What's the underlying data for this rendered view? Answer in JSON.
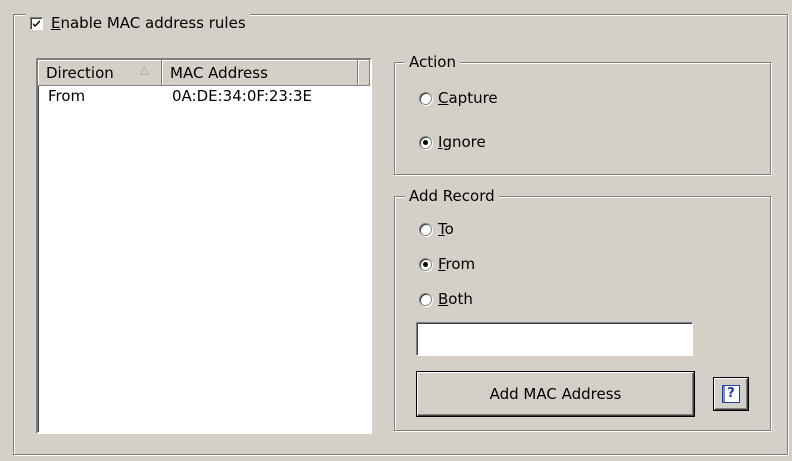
{
  "mac_rules": {
    "enable_label": "Enable MAC address rules",
    "enabled": true
  },
  "list": {
    "columns": [
      "Direction",
      "MAC Address"
    ],
    "sort_indicator": "△",
    "rows": [
      {
        "direction": "From",
        "mac": "0A:DE:34:0F:23:3E"
      }
    ]
  },
  "action": {
    "title": "Action",
    "options": [
      {
        "label": "Capture",
        "selected": false
      },
      {
        "label": "Ignore",
        "selected": true
      }
    ]
  },
  "add_record": {
    "title": "Add Record",
    "options": [
      {
        "label": "To",
        "selected": false
      },
      {
        "label": "From",
        "selected": true
      },
      {
        "label": "Both",
        "selected": false
      }
    ],
    "mac_input_value": "",
    "add_button_label": "Add MAC Address",
    "help_icon": "help-book-icon",
    "help_icon_glyph": "?"
  },
  "colors": {
    "dialog_bg": "#d4d0c8",
    "shadow": "#808080",
    "highlight": "#ffffff",
    "help_icon_blue": "#1c3fa8"
  }
}
